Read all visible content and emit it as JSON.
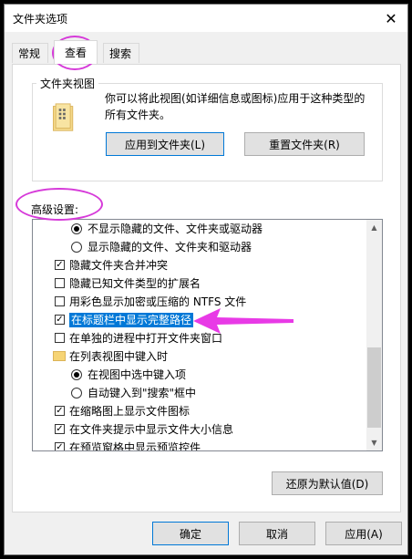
{
  "window": {
    "title": "文件夹选项",
    "close_glyph": "✕"
  },
  "tabs": [
    {
      "label": "常规"
    },
    {
      "label": "查看"
    },
    {
      "label": "搜索"
    }
  ],
  "folder_views": {
    "group_label": "文件夹视图",
    "description": "你可以将此视图(如详细信息或图标)应用于这种类型的所有文件夹。",
    "apply_button": "应用到文件夹(L)",
    "reset_button": "重置文件夹(R)"
  },
  "advanced": {
    "label": "高级设置:",
    "items": [
      {
        "type": "radio",
        "checked": true,
        "label": "不显示隐藏的文件、文件夹或驱动器"
      },
      {
        "type": "radio",
        "checked": false,
        "label": "显示隐藏的文件、文件夹和驱动器"
      },
      {
        "type": "checkbox",
        "checked": true,
        "label": "隐藏文件夹合并冲突"
      },
      {
        "type": "checkbox",
        "checked": false,
        "label": "隐藏已知文件类型的扩展名"
      },
      {
        "type": "checkbox",
        "checked": false,
        "label": "用彩色显示加密或压缩的 NTFS 文件"
      },
      {
        "type": "checkbox",
        "checked": true,
        "label": "在标题栏中显示完整路径",
        "selected": true
      },
      {
        "type": "checkbox",
        "checked": false,
        "label": "在单独的进程中打开文件夹窗口"
      },
      {
        "type": "folder",
        "label": "在列表视图中键入时"
      },
      {
        "type": "radio",
        "checked": true,
        "label": "在视图中选中键入项"
      },
      {
        "type": "radio",
        "checked": false,
        "label": "自动键入到\"搜索\"框中"
      },
      {
        "type": "checkbox",
        "checked": true,
        "label": "在缩略图上显示文件图标"
      },
      {
        "type": "checkbox",
        "checked": true,
        "label": "在文件夹提示中显示文件大小信息"
      },
      {
        "type": "checkbox",
        "checked": true,
        "label": "在预览窗格中显示预览控件"
      }
    ],
    "restore_button": "还原为默认值(D)"
  },
  "footer": {
    "ok": "确定",
    "cancel": "取消",
    "apply": "应用(A)"
  },
  "colors": {
    "selection": "#0078d7",
    "annotation": "#d63ad9"
  }
}
